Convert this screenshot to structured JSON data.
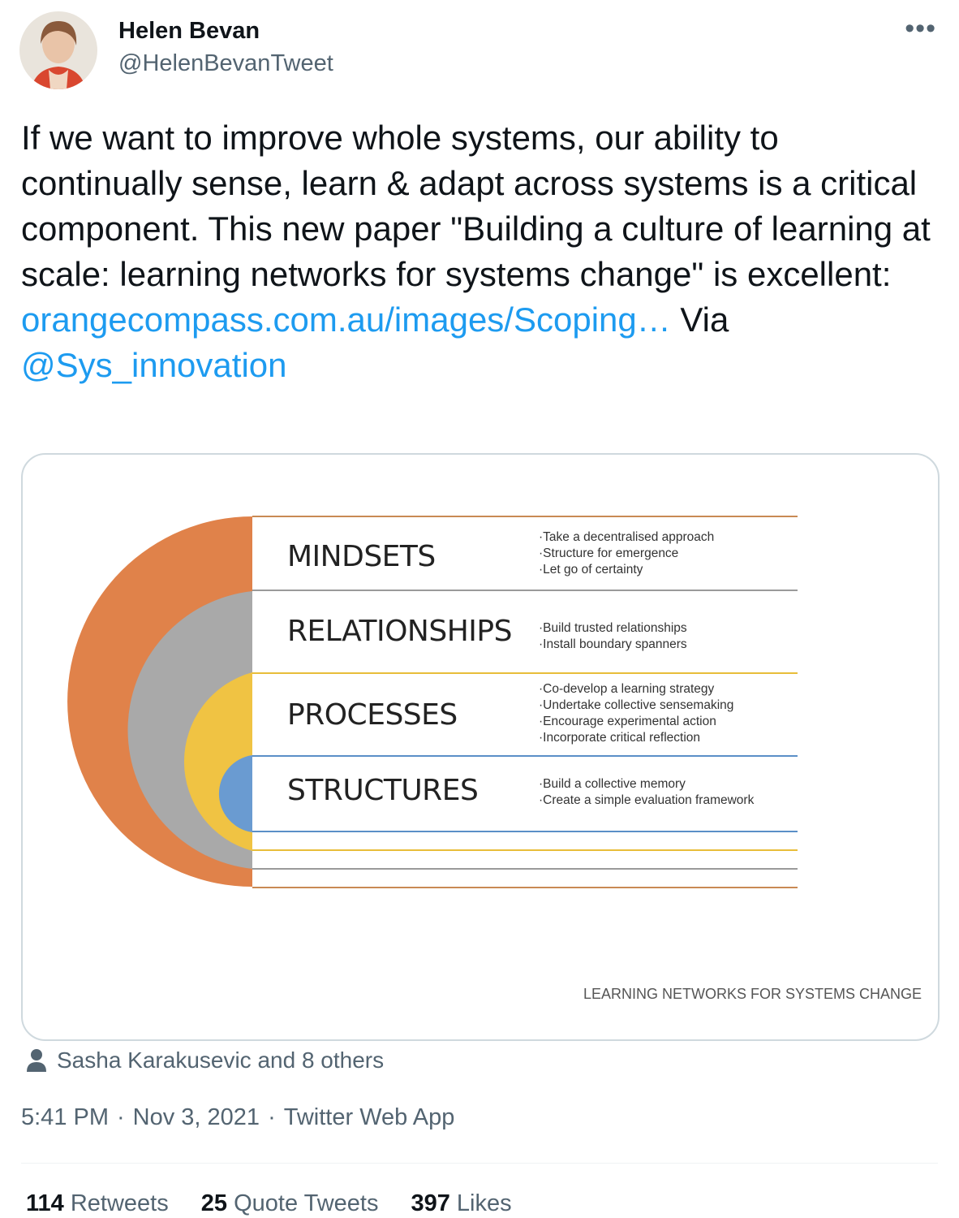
{
  "author": {
    "name": "Helen Bevan",
    "handle": "@HelenBevanTweet"
  },
  "more_icon": "more-horizontal-icon",
  "tweet": {
    "text_before_link": "If we want to improve whole systems, our ability to continually sense, learn & adapt across systems is a critical component. This new paper \"Building a culture of learning at scale: learning networks for systems change\" is excellent: ",
    "link_text": "orangecompass.com.au/images/Scoping…",
    "text_via": " Via ",
    "mention": "@Sys_innovation"
  },
  "media": {
    "layers": [
      {
        "label": "MINDSETS",
        "color": "#e0824a",
        "bullets": [
          "Take a decentralised approach",
          "Structure for emergence",
          "Let go of certainty"
        ]
      },
      {
        "label": "RELATIONSHIPS",
        "color": "#a9a9a9",
        "bullets": [
          "Build trusted relationships",
          "Install boundary spanners"
        ]
      },
      {
        "label": "PROCESSES",
        "color": "#f0c343",
        "bullets": [
          "Co-develop a learning strategy",
          "Undertake collective sensemaking",
          "Encourage experimental action",
          "Incorporate critical reflection"
        ]
      },
      {
        "label": "STRUCTURES",
        "color": "#6a9bd1",
        "bullets": [
          "Build a collective memory",
          "Create a simple evaluation framework"
        ]
      }
    ],
    "caption": "LEARNING NETWORKS FOR SYSTEMS CHANGE"
  },
  "liked_by": {
    "icon": "person-icon",
    "text": "Sasha Karakusevic and 8 others"
  },
  "meta": {
    "time": "5:41 PM",
    "date": "Nov 3, 2021",
    "source": "Twitter Web App",
    "separator": "·"
  },
  "stats": {
    "retweets_count": "114",
    "retweets_label": " Retweets",
    "quotes_count": "25",
    "quotes_label": " Quote Tweets",
    "likes_count": "397",
    "likes_label": " Likes"
  }
}
